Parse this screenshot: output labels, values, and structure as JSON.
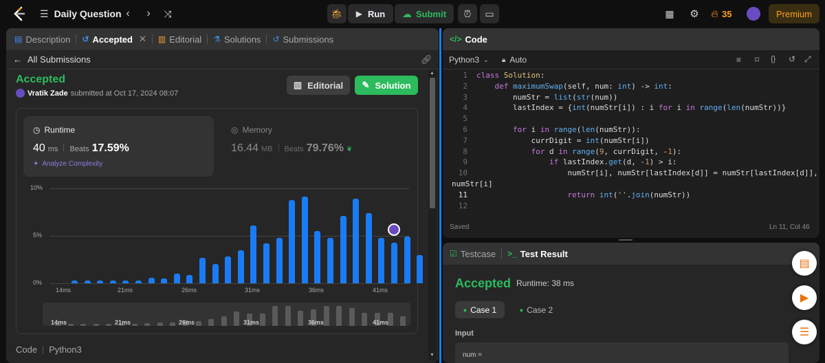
{
  "topbar": {
    "problem_list_label": "Daily Question",
    "run_label": "Run",
    "submit_label": "Submit",
    "streak": "35",
    "premium_label": "Premium"
  },
  "left_panel": {
    "tabs": [
      {
        "label": "Description"
      },
      {
        "label": "Accepted"
      },
      {
        "label": "Editorial"
      },
      {
        "label": "Solutions"
      },
      {
        "label": "Submissions"
      }
    ],
    "back_label": "All Submissions",
    "status": "Accepted",
    "user": "Vratik Zade",
    "submitted_text": "submitted at Oct 17, 2024 08:07",
    "editorial_button": "Editorial",
    "solution_button": "Solution",
    "runtime": {
      "title": "Runtime",
      "value": "40",
      "unit": "ms",
      "beats_label": "Beats",
      "beats_value": "17.59%",
      "analyze_label": "Analyze Complexity"
    },
    "memory": {
      "title": "Memory",
      "value": "16.44",
      "unit": "MB",
      "beats_label": "Beats",
      "beats_value": "79.76%"
    },
    "footer": {
      "code_label": "Code",
      "lang_label": "Python3"
    }
  },
  "chart_data": {
    "type": "bar",
    "ytick_labels": [
      "10%",
      "5%",
      "0%"
    ],
    "ylim": [
      0,
      10
    ],
    "xtick_labels": [
      "14ms",
      "21ms",
      "26ms",
      "31ms",
      "36ms",
      "41ms"
    ],
    "values": [
      0.3,
      0.3,
      0.3,
      0.3,
      0.3,
      0.3,
      0.6,
      0.5,
      1.0,
      0.9,
      2.7,
      2.0,
      2.8,
      3.5,
      6.1,
      4.2,
      4.8,
      8.8,
      9.1,
      5.5,
      4.8,
      7.1,
      8.9,
      7.4,
      4.8,
      4.3,
      4.9,
      3.0
    ],
    "highlight_index": 25,
    "minimap_values": [
      0.3,
      0.3,
      0.3,
      0.3,
      0.4,
      0.5,
      0.5,
      0.6,
      0.8,
      0.8,
      1.2,
      1.0,
      1.5,
      2.0,
      3.1,
      2.7,
      2.6,
      4.3,
      4.3,
      3.3,
      3.6,
      4.2,
      4.2,
      3.8,
      2.8,
      2.8,
      2.8,
      2.0,
      1.5
    ]
  },
  "code_panel": {
    "title": "Code",
    "language": "Python3",
    "auto_label": "Auto",
    "saved_label": "Saved",
    "cursor_label": "Ln 11, Col 46",
    "lines": [
      {
        "n": "1",
        "text": "class Solution:"
      },
      {
        "n": "2",
        "text": "    def maximumSwap(self, num: int) -> int:"
      },
      {
        "n": "3",
        "text": "        numStr = list(str(num))"
      },
      {
        "n": "4",
        "text": "        lastIndex = {int(numStr[i]) : i for i in range(len(numStr))}"
      },
      {
        "n": "5",
        "text": ""
      },
      {
        "n": "6",
        "text": "        for i in range(len(numStr)):"
      },
      {
        "n": "7",
        "text": "            currDigit = int(numStr[i])"
      },
      {
        "n": "8",
        "text": "            for d in range(9, currDigit, -1):"
      },
      {
        "n": "9",
        "text": "                if lastIndex.get(d, -1) > i:"
      },
      {
        "n": "10",
        "text": "                    numStr[i], numStr[lastIndex[d]] = numStr[lastIndex[d]],"
      },
      {
        "n": "",
        "text": "numStr[i]"
      },
      {
        "n": "11",
        "text": "                    return int(''.join(numStr))"
      },
      {
        "n": "12",
        "text": ""
      }
    ]
  },
  "result_panel": {
    "testcase_tab": "Testcase",
    "result_tab": "Test Result",
    "status": "Accepted",
    "runtime_text": "Runtime: 38 ms",
    "case1": "Case 1",
    "case2": "Case 2",
    "input_label": "Input",
    "input_value": "num ="
  },
  "colors": {
    "accent_green": "#2cbb5d",
    "accent_blue": "#1a7cf5",
    "brand_orange": "#ffa116"
  }
}
